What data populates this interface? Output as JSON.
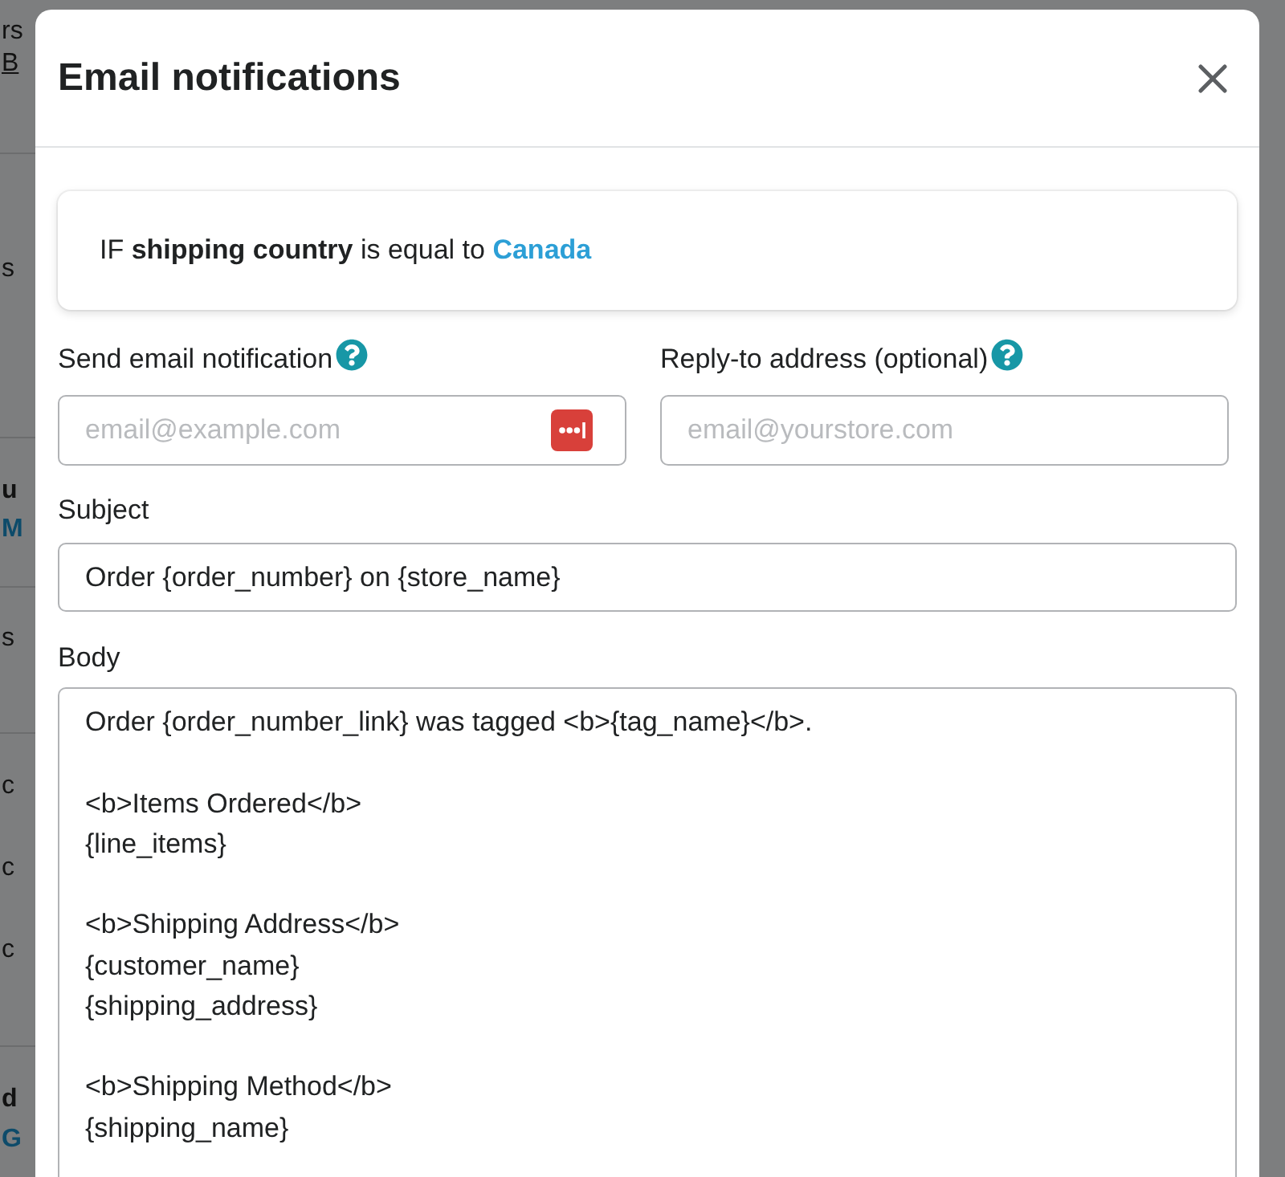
{
  "background_page": {
    "sections": [
      {
        "items": [
          {
            "text": "rs",
            "kind": "plain"
          },
          {
            "text": "B",
            "kind": "underlined"
          }
        ]
      },
      {
        "items": [
          {
            "text": "s",
            "kind": "plain"
          }
        ]
      },
      {
        "items": [
          {
            "text": "u",
            "kind": "bold"
          },
          {
            "text": "M",
            "kind": "link"
          }
        ]
      },
      {
        "items": [
          {
            "text": "s",
            "kind": "plain"
          }
        ]
      },
      {
        "items": [
          {
            "text": "c",
            "kind": "plain"
          },
          {
            "text": "c",
            "kind": "plain"
          },
          {
            "text": "c",
            "kind": "plain"
          }
        ]
      },
      {
        "items": [
          {
            "text": "d",
            "kind": "bold"
          },
          {
            "text": "G",
            "kind": "link"
          }
        ]
      }
    ]
  },
  "dialog": {
    "title": "Email notifications",
    "condition": {
      "text": "IF **shipping country** is equal to",
      "value": "Canada"
    },
    "recipients": [
      {
        "label": "Send email notification",
        "help": true,
        "placeholder": "email@example.com",
        "fill_icon": true
      },
      {
        "label": "Reply-to address (optional)",
        "help": true,
        "placeholder": "email@yourstore.com",
        "fill_icon": false
      }
    ],
    "subject": {
      "label": "Subject",
      "value": "Order {order_number} on {store_name}"
    },
    "body": {
      "label": "Body",
      "value": "Order {order_number_link} was tagged <b>{tag_name}</b>.\n\n<b>Items Ordered</b>\n{line_items}\n\n<b>Shipping Address</b>\n{customer_name}\n{shipping_address}\n\n<b>Shipping Method</b>\n{shipping_name}"
    }
  }
}
